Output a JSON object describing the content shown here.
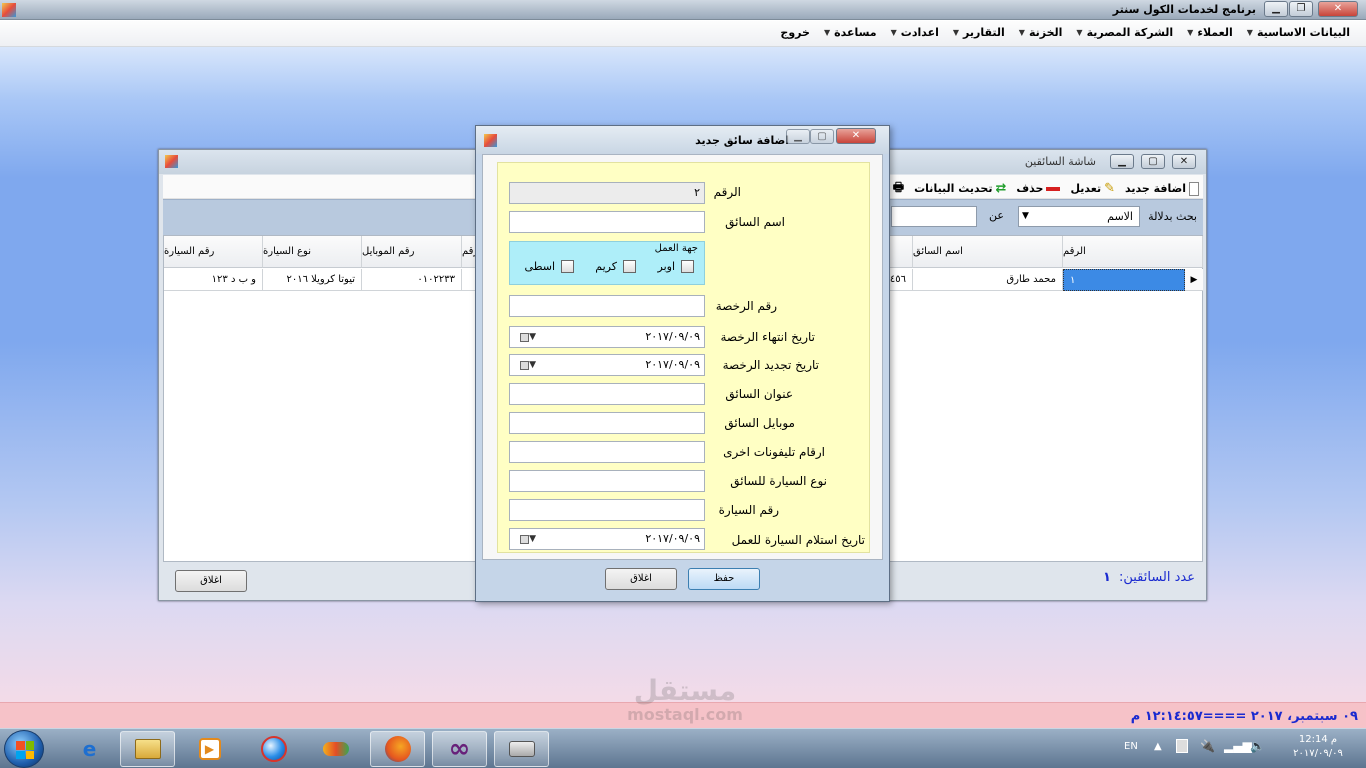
{
  "app": {
    "title": "برنامج لخدمات الكول سنتر"
  },
  "menu": [
    {
      "label": "البيانات الاساسية"
    },
    {
      "label": "العملاء"
    },
    {
      "label": "الشركة المصرية"
    },
    {
      "label": "الخزنة"
    },
    {
      "label": "التقارير"
    },
    {
      "label": "اعدادت"
    },
    {
      "label": "مساعدة"
    },
    {
      "label": "خروج"
    }
  ],
  "drivers_window": {
    "title": "شاشة السائقين",
    "toolbar": {
      "add": "اضافة جديد",
      "edit": "تعديل",
      "delete": "حذف",
      "refresh": "تحديث البيانات",
      "print_partial": "ط"
    },
    "search": {
      "label": "بحث بدلالة",
      "field_value": "الاسم",
      "about_label": "عن",
      "query_value": ""
    },
    "columns": [
      "الرقم",
      "اسم السائق",
      "رقم",
      "رقم الموبايل",
      "نوع السيارة",
      "رقم السيارة"
    ],
    "rows": [
      {
        "id": "١",
        "name": "محمد طارق",
        "partial": "٤٥٦",
        "mobile": "٠١٠٢٢٣٣",
        "car_type": "تيوتا كرويلا ٢٠١٦",
        "car_number": "و ب د ١٢٣"
      }
    ],
    "count_label": "عدد السائقين:",
    "count_value": "١",
    "close_button": "اغلاق"
  },
  "dialog": {
    "title": "اضافة سائق جديد",
    "fields": {
      "number_label": "الرقم",
      "number_value": "٢",
      "driver_name_label": "اسم السائق",
      "work_group_label": "جهة العمل",
      "work_options": [
        "اوبر",
        "كريم",
        "اسطى"
      ],
      "license_number_label": "رقم الرخصة",
      "license_expiry_label": "تاريخ انتهاء الرخصة",
      "license_expiry_value": "٢٠١٧/٠٩/٠٩",
      "license_renew_label": "تاريخ تجديد الرخصة",
      "license_renew_value": "٢٠١٧/٠٩/٠٩",
      "address_label": "عنوان السائق",
      "mobile_label": "موبايل السائق",
      "other_phones_label": "ارقام تليفونات اخرى",
      "car_type_label": "نوع السيارة للسائق",
      "car_number_label": "رقم السيارة",
      "car_receive_label": "تاريخ استلام السيارة للعمل",
      "car_receive_value": "٢٠١٧/٠٩/٠٩"
    },
    "save_button": "حفظ",
    "close_button": "اغلاق"
  },
  "status_bar": {
    "text": "٠٩ سبتمبر، ٢٠١٧ ====١٢:١٤:٥٧ م"
  },
  "watermark": {
    "brand": "مستقل",
    "url": "mostaql.com"
  },
  "taskbar": {
    "language": "EN",
    "time": "12:14 م",
    "date": "٢٠١٧/٠٩/٠٩"
  }
}
